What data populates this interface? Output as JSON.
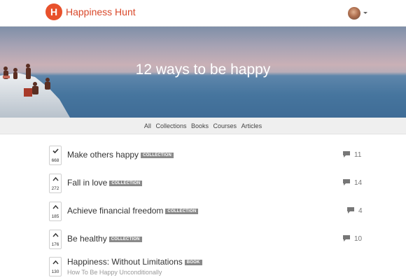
{
  "header": {
    "logo_letter": "H",
    "brand": "Happiness Hunt"
  },
  "hero": {
    "title": "12 ways to be happy"
  },
  "filters": [
    "All",
    "Collections",
    "Books",
    "Courses",
    "Articles"
  ],
  "items": [
    {
      "title": "Make others happy",
      "badge": "COLLECTION",
      "votes": "668",
      "voted": true,
      "comments": "11"
    },
    {
      "title": "Fall in love",
      "badge": "COLLECTION",
      "votes": "272",
      "voted": false,
      "comments": "14"
    },
    {
      "title": "Achieve financial freedom",
      "badge": "COLLECTION",
      "votes": "185",
      "voted": false,
      "comments": "4"
    },
    {
      "title": "Be healthy",
      "badge": "COLLECTION",
      "votes": "176",
      "voted": false,
      "comments": "10"
    },
    {
      "title": "Happiness: Without Limitations",
      "badge": "BOOK",
      "votes": "130",
      "voted": false,
      "subtitle": "How To Be Happy Unconditionally"
    }
  ]
}
